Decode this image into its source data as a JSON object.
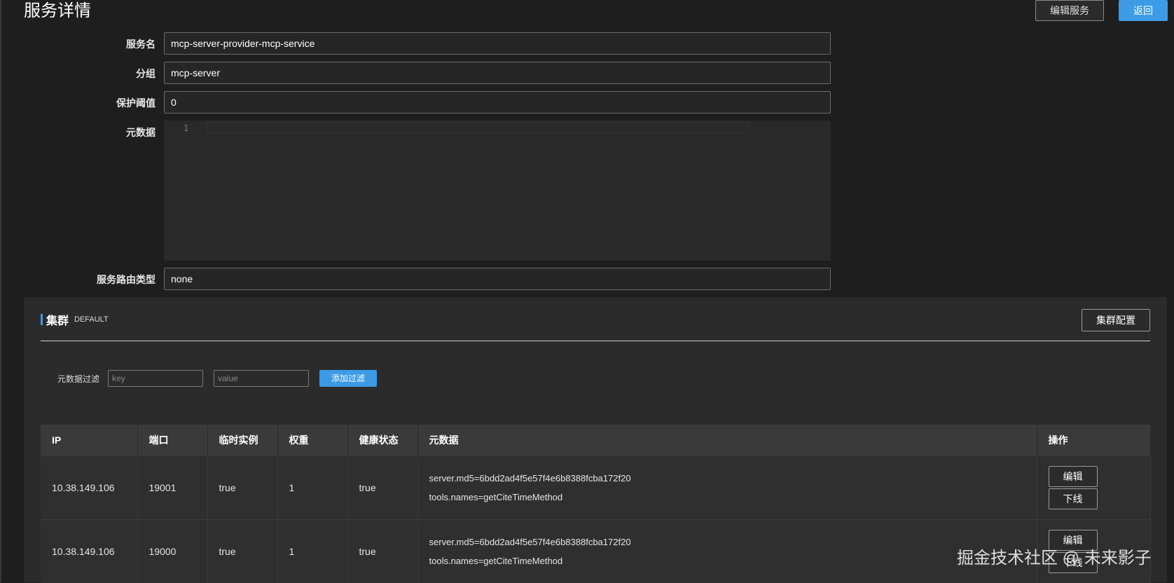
{
  "page": {
    "title": "服务详情",
    "edit_service_label": "编辑服务",
    "back_label": "返回"
  },
  "form": {
    "service_name_label": "服务名",
    "service_name_value": "mcp-server-provider-mcp-service",
    "group_label": "分组",
    "group_value": "mcp-server",
    "protect_threshold_label": "保护阈值",
    "protect_threshold_value": "0",
    "metadata_label": "元数据",
    "metadata_line_number": "1",
    "route_type_label": "服务路由类型",
    "route_type_value": "none"
  },
  "cluster": {
    "title": "集群",
    "name": "DEFAULT",
    "config_label": "集群配置",
    "filter_label": "元数据过滤",
    "key_placeholder": "key",
    "value_placeholder": "value",
    "add_filter_label": "添加过滤"
  },
  "table": {
    "columns": [
      "IP",
      "端口",
      "临时实例",
      "权重",
      "健康状态",
      "元数据",
      "操作"
    ],
    "rows": [
      {
        "ip": "10.38.149.106",
        "port": "19001",
        "ephemeral": "true",
        "weight": "1",
        "healthy": "true",
        "meta_1": "server.md5=6bdd2ad4f5e57f4e6b8388fcba172f20",
        "meta_2": "tools.names=getCiteTimeMethod",
        "edit_label": "编辑",
        "offline_label": "下线"
      },
      {
        "ip": "10.38.149.106",
        "port": "19000",
        "ephemeral": "true",
        "weight": "1",
        "healthy": "true",
        "meta_1": "server.md5=6bdd2ad4f5e57f4e6b8388fcba172f20",
        "meta_2": "tools.names=getCiteTimeMethod",
        "edit_label": "编辑",
        "offline_label": "下线"
      }
    ]
  },
  "watermark": "掘金技术社区 @ 未来影子"
}
